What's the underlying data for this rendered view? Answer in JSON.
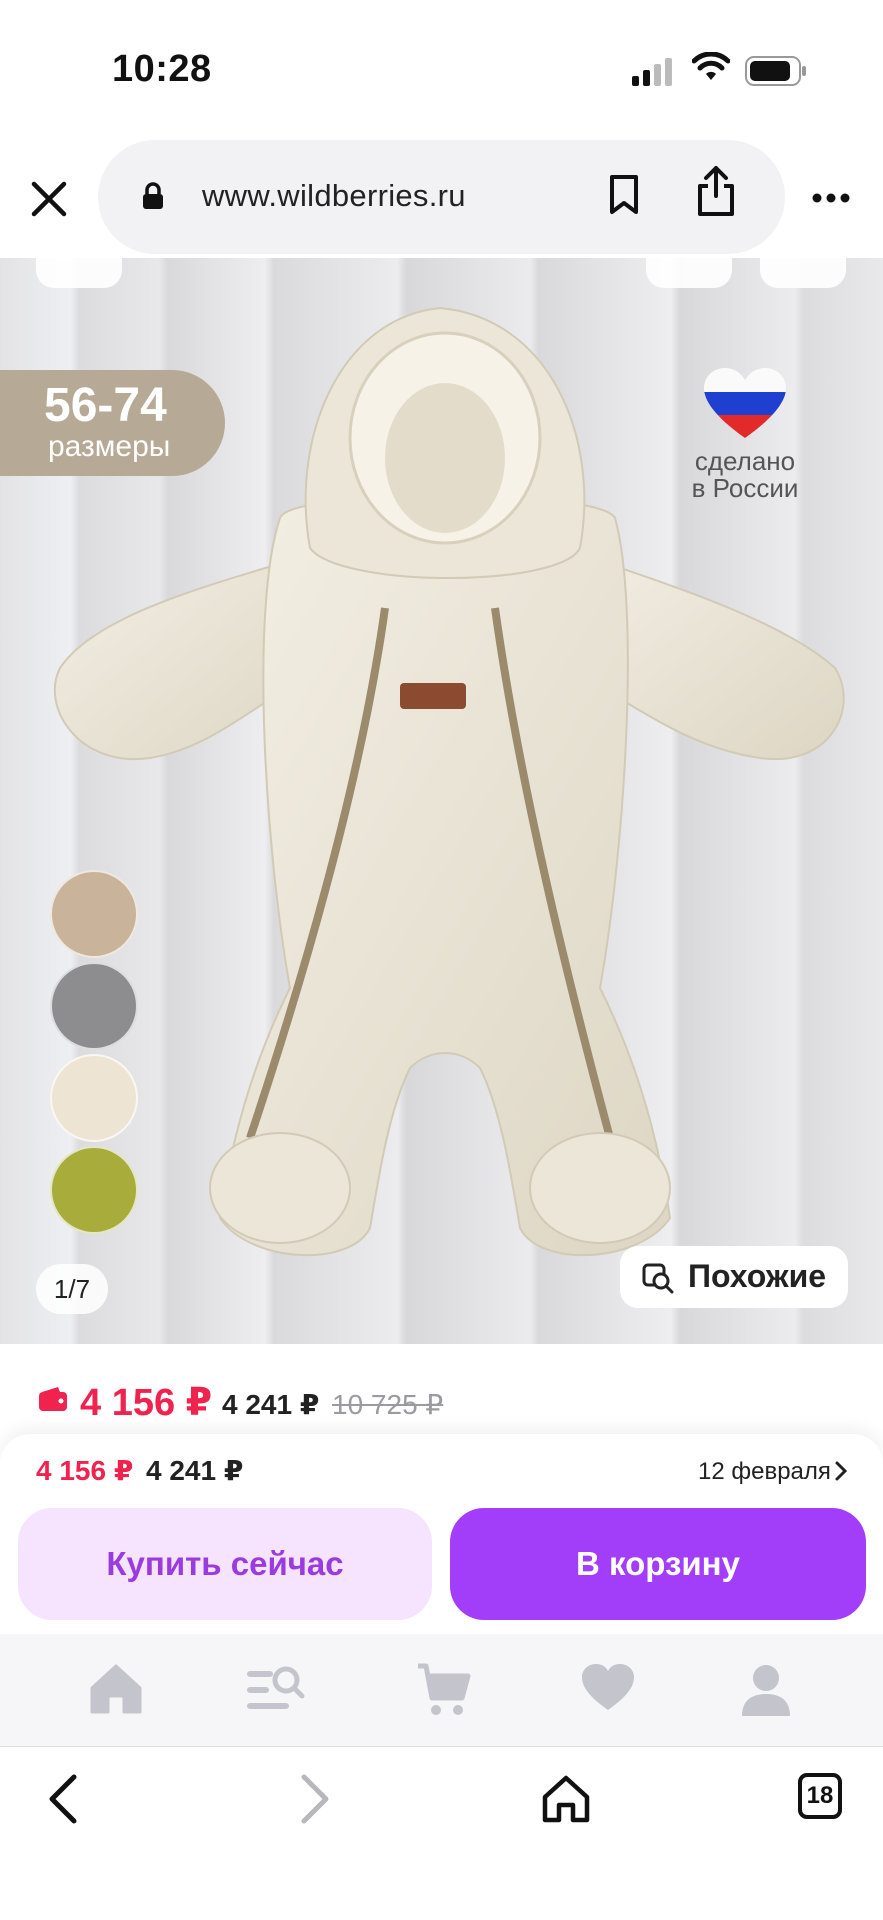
{
  "status_bar": {
    "time": "10:28"
  },
  "browser": {
    "url": "www.wildberries.ru",
    "icons": [
      "close-icon",
      "lock-icon",
      "bookmark-icon",
      "share-icon",
      "more-icon"
    ]
  },
  "gallery": {
    "size_badge": {
      "range": "56-74",
      "label": "размеры"
    },
    "made_in": {
      "line1": "сделано",
      "line2": "в России"
    },
    "color_swatches": [
      "#c9b39a",
      "#8d8d8f",
      "#eee4d4",
      "#a7ac3a"
    ],
    "counter": "1/7",
    "similar_label": "Похожие"
  },
  "price": {
    "wallet_price": "4 156 ₽",
    "regular_price": "4 241 ₽",
    "old_price": "10 725 ₽"
  },
  "buy_panel": {
    "wallet_price": "4 156 ₽",
    "regular_price": "4 241 ₽",
    "delivery_date": "12 февраля",
    "buy_now_label": "Купить сейчас",
    "add_to_cart_label": "В корзину"
  },
  "tabbar": {
    "items": [
      "home-icon",
      "catalog-search-icon",
      "cart-icon",
      "favorites-icon",
      "profile-icon"
    ]
  },
  "browser_nav": {
    "tabs_count": "18"
  },
  "colors": {
    "accent": "#a23dfa",
    "price_red": "#f0224e"
  }
}
